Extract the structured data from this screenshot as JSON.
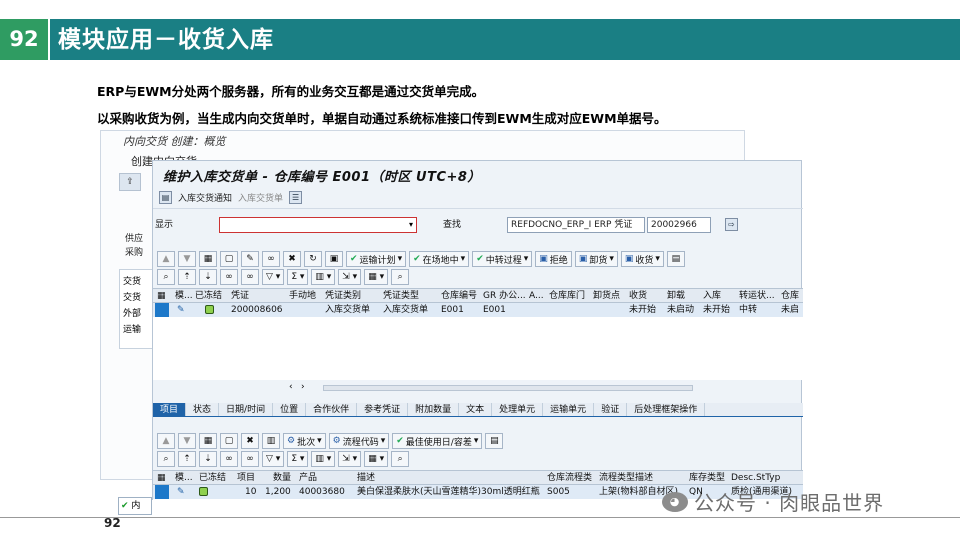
{
  "slide": {
    "number": "92",
    "title": "模块应用－收货入库",
    "line1": "ERP与EWM分处两个服务器，所有的业务交互都是通过交货单完成。",
    "line2": "以采购收货为例，当生成内向交货单时，单据自动通过系统标准接口传到EWM生成对应EWM单据号。",
    "page_number": "92"
  },
  "back_window": {
    "title1": "内向交货 创建：概览",
    "title2": "创建内向交货",
    "side_labels": [
      "供应",
      "采购",
      "交货",
      "交货",
      "外部",
      "运输"
    ]
  },
  "main_window": {
    "title": "维护入库交货单 - 仓库编号 E001（时区 UTC+8）",
    "toolbar": {
      "notice": "入库交货通知",
      "delivery": "入库交货单"
    },
    "display_label": "显示",
    "display_value": "",
    "search_label": "查找",
    "search_type": "REFDOCNO_ERP_I ERP 凭证",
    "search_value": "20002966",
    "upper_toolbar_buttons": [
      "运输计划",
      "在场地中",
      "中转过程",
      "拒绝",
      "卸货",
      "收货"
    ],
    "upper_grid": {
      "columns": [
        "模...",
        "已冻结",
        "凭证",
        "手动地",
        "凭证类别",
        "凭证类型",
        "仓库编号",
        "GR 办公...",
        "A...",
        "仓库库门",
        "卸货点",
        "收货",
        "卸载",
        "入库",
        "转运状...",
        "仓库"
      ],
      "row": {
        "doc": "200008606",
        "doc_category": "入库交货单",
        "doc_type": "入库交货单",
        "warehouse": "E001",
        "gr_office": "E001",
        "gr_status": "未开始",
        "unload_status": "未启动",
        "putaway_status": "未开始",
        "transit_status": "中转",
        "warehouse_status": "未启"
      }
    },
    "tabs": [
      "项目",
      "状态",
      "日期/时间",
      "位置",
      "合作伙伴",
      "参考凭证",
      "附加数量",
      "文本",
      "处理单元",
      "运输单元",
      "验证",
      "后处理框架操作"
    ],
    "lower_toolbar_buttons": [
      "批次",
      "流程代码",
      "最佳使用日/容差"
    ],
    "lower_grid": {
      "columns": [
        "模...",
        "已冻结",
        "项目",
        "数量",
        "产品",
        "描述",
        "仓库流程类",
        "流程类型描述",
        "库存类型",
        "Desc.StTyp"
      ],
      "row": {
        "item": "10",
        "qty": "1,200",
        "product": "40003680",
        "description": "美白保湿柔肤水(天山雪莲精华)30ml透明红瓶",
        "process_type": "S005",
        "process_desc": "上架(物料部自材区)",
        "stock_type": "QN",
        "stock_desc": "质检(通用渠道)"
      }
    },
    "status_text": "内"
  },
  "watermark": "公众号 · 肉眼品世界"
}
